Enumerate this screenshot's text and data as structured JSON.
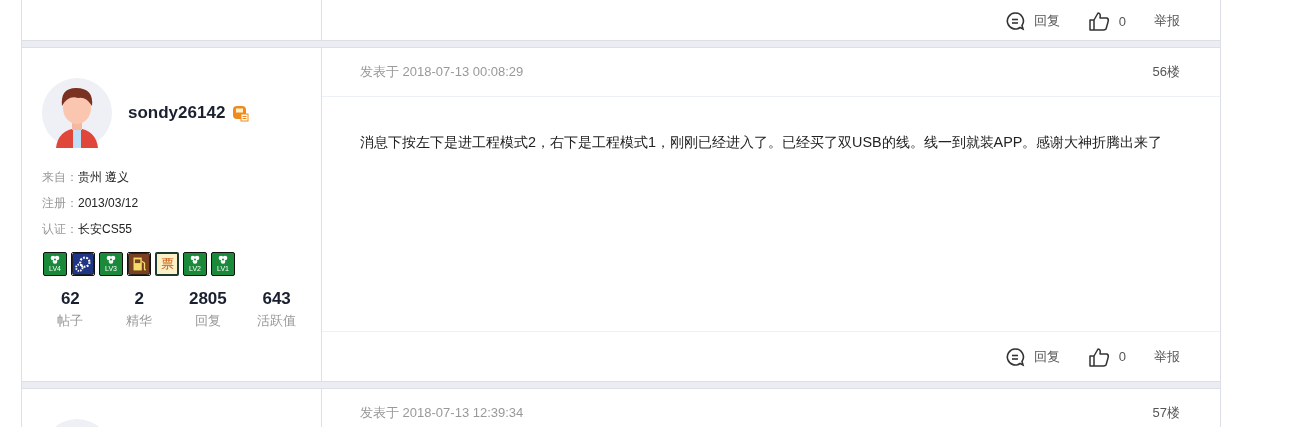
{
  "posts": [
    {
      "kind": "footer",
      "actions": {
        "reply": "回复",
        "likes": "0",
        "report": "举报"
      }
    },
    {
      "kind": "full",
      "user": {
        "name": "sondy26142",
        "from_label": "来自：",
        "from": "贵州 遵义",
        "reg_label": "注册：",
        "reg": "2013/03/12",
        "cert_label": "认证：",
        "cert": "长安CS55",
        "badges": [
          {
            "kind": "level",
            "label": "LV4"
          },
          {
            "kind": "gear"
          },
          {
            "kind": "level",
            "label": "LV3"
          },
          {
            "kind": "fuel"
          },
          {
            "kind": "ticket",
            "label": "票"
          },
          {
            "kind": "level",
            "label": "LV2"
          },
          {
            "kind": "level",
            "label": "LV1"
          }
        ],
        "stats": [
          {
            "value": "62",
            "label": "帖子"
          },
          {
            "value": "2",
            "label": "精华"
          },
          {
            "value": "2805",
            "label": "回复"
          },
          {
            "value": "643",
            "label": "活跃值"
          }
        ]
      },
      "date": "发表于 2018-07-13 00:08:29",
      "floor": "56楼",
      "text": "消息下按左下是进工程模式2，右下是工程模式1，刚刚已经进入了。已经买了双USB的线。线一到就装APP。感谢大神折腾出来了",
      "actions": {
        "reply": "回复",
        "likes": "0",
        "report": "举报"
      }
    },
    {
      "kind": "header",
      "date": "发表于 2018-07-13 12:39:34",
      "floor": "57楼"
    }
  ]
}
